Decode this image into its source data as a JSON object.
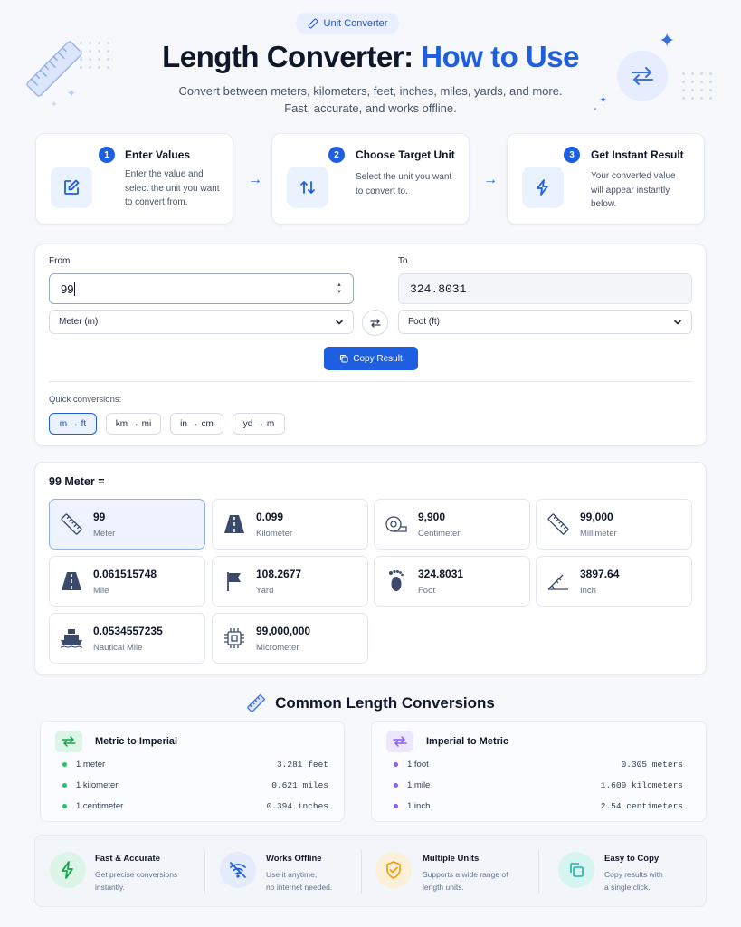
{
  "header": {
    "badge": "Unit Converter",
    "title_main": "Length Converter:",
    "title_accent": "How to Use",
    "subtitle_line1": "Convert between meters, kilometers, feet, inches, miles, yards, and more.",
    "subtitle_line2": "Fast, accurate, and works offline."
  },
  "steps": [
    {
      "num": "1",
      "title": "Enter Values",
      "desc": "Enter the value and select the unit you want to convert from.",
      "icon": "edit-icon"
    },
    {
      "num": "2",
      "title": "Choose Target Unit",
      "desc": "Select the unit you want to convert to.",
      "icon": "swap-vertical-icon"
    },
    {
      "num": "3",
      "title": "Get Instant Result",
      "desc": "Your converted value will appear instantly below.",
      "icon": "lightning-icon"
    }
  ],
  "converter": {
    "from_label": "From",
    "to_label": "To",
    "from_value": "99",
    "to_value": "324.8031",
    "from_unit": "Meter (m)",
    "to_unit": "Foot (ft)",
    "copy_label": "Copy Result",
    "quick_label": "Quick conversions:",
    "quick": [
      "m → ft",
      "km → mi",
      "in → cm",
      "yd → m"
    ]
  },
  "results": {
    "heading": "99 Meter =",
    "items": [
      {
        "value": "99",
        "name": "Meter",
        "icon": "ruler-icon"
      },
      {
        "value": "0.099",
        "name": "Kilometer",
        "icon": "road-icon"
      },
      {
        "value": "9,900",
        "name": "Centimeter",
        "icon": "tape-measure-icon"
      },
      {
        "value": "99,000",
        "name": "Millimeter",
        "icon": "ruler-icon"
      },
      {
        "value": "0.061515748",
        "name": "Mile",
        "icon": "road-icon"
      },
      {
        "value": "108.2677",
        "name": "Yard",
        "icon": "flag-icon"
      },
      {
        "value": "324.8031",
        "name": "Foot",
        "icon": "footprint-icon"
      },
      {
        "value": "3897.64",
        "name": "Inch",
        "icon": "angle-ruler-icon"
      },
      {
        "value": "0.0534557235",
        "name": "Nautical Mile",
        "icon": "ship-icon"
      },
      {
        "value": "99,000,000",
        "name": "Micrometer",
        "icon": "chip-icon"
      }
    ]
  },
  "common": {
    "title": "Common Length Conversions",
    "metric": {
      "title": "Metric to Imperial",
      "rows": [
        {
          "from": "1 meter",
          "to": "3.281 feet"
        },
        {
          "from": "1 kilometer",
          "to": "0.621 miles"
        },
        {
          "from": "1 centimeter",
          "to": "0.394 inches"
        }
      ]
    },
    "imperial": {
      "title": "Imperial to Metric",
      "rows": [
        {
          "from": "1 foot",
          "to": "0.305 meters"
        },
        {
          "from": "1 mile",
          "to": "1.609 kilometers"
        },
        {
          "from": "1 inch",
          "to": "2.54 centimeters"
        }
      ]
    }
  },
  "features": [
    {
      "title": "Fast & Accurate",
      "l1": "Get precise conversions",
      "l2": "instantly.",
      "icon": "lightning-icon"
    },
    {
      "title": "Works Offline",
      "l1": "Use it anytime,",
      "l2": "no internet needed.",
      "icon": "wifi-off-icon"
    },
    {
      "title": "Multiple Units",
      "l1": "Supports a wide range of",
      "l2": "length units.",
      "icon": "shield-icon"
    },
    {
      "title": "Easy to Copy",
      "l1": "Copy results with",
      "l2": "a single click.",
      "icon": "copy-icon"
    }
  ],
  "colors": {
    "accent": "#1d5fe0",
    "green": "#22c55e",
    "purple": "#8b5cf6",
    "orange": "#f59e0b",
    "teal": "#14b8a6"
  }
}
